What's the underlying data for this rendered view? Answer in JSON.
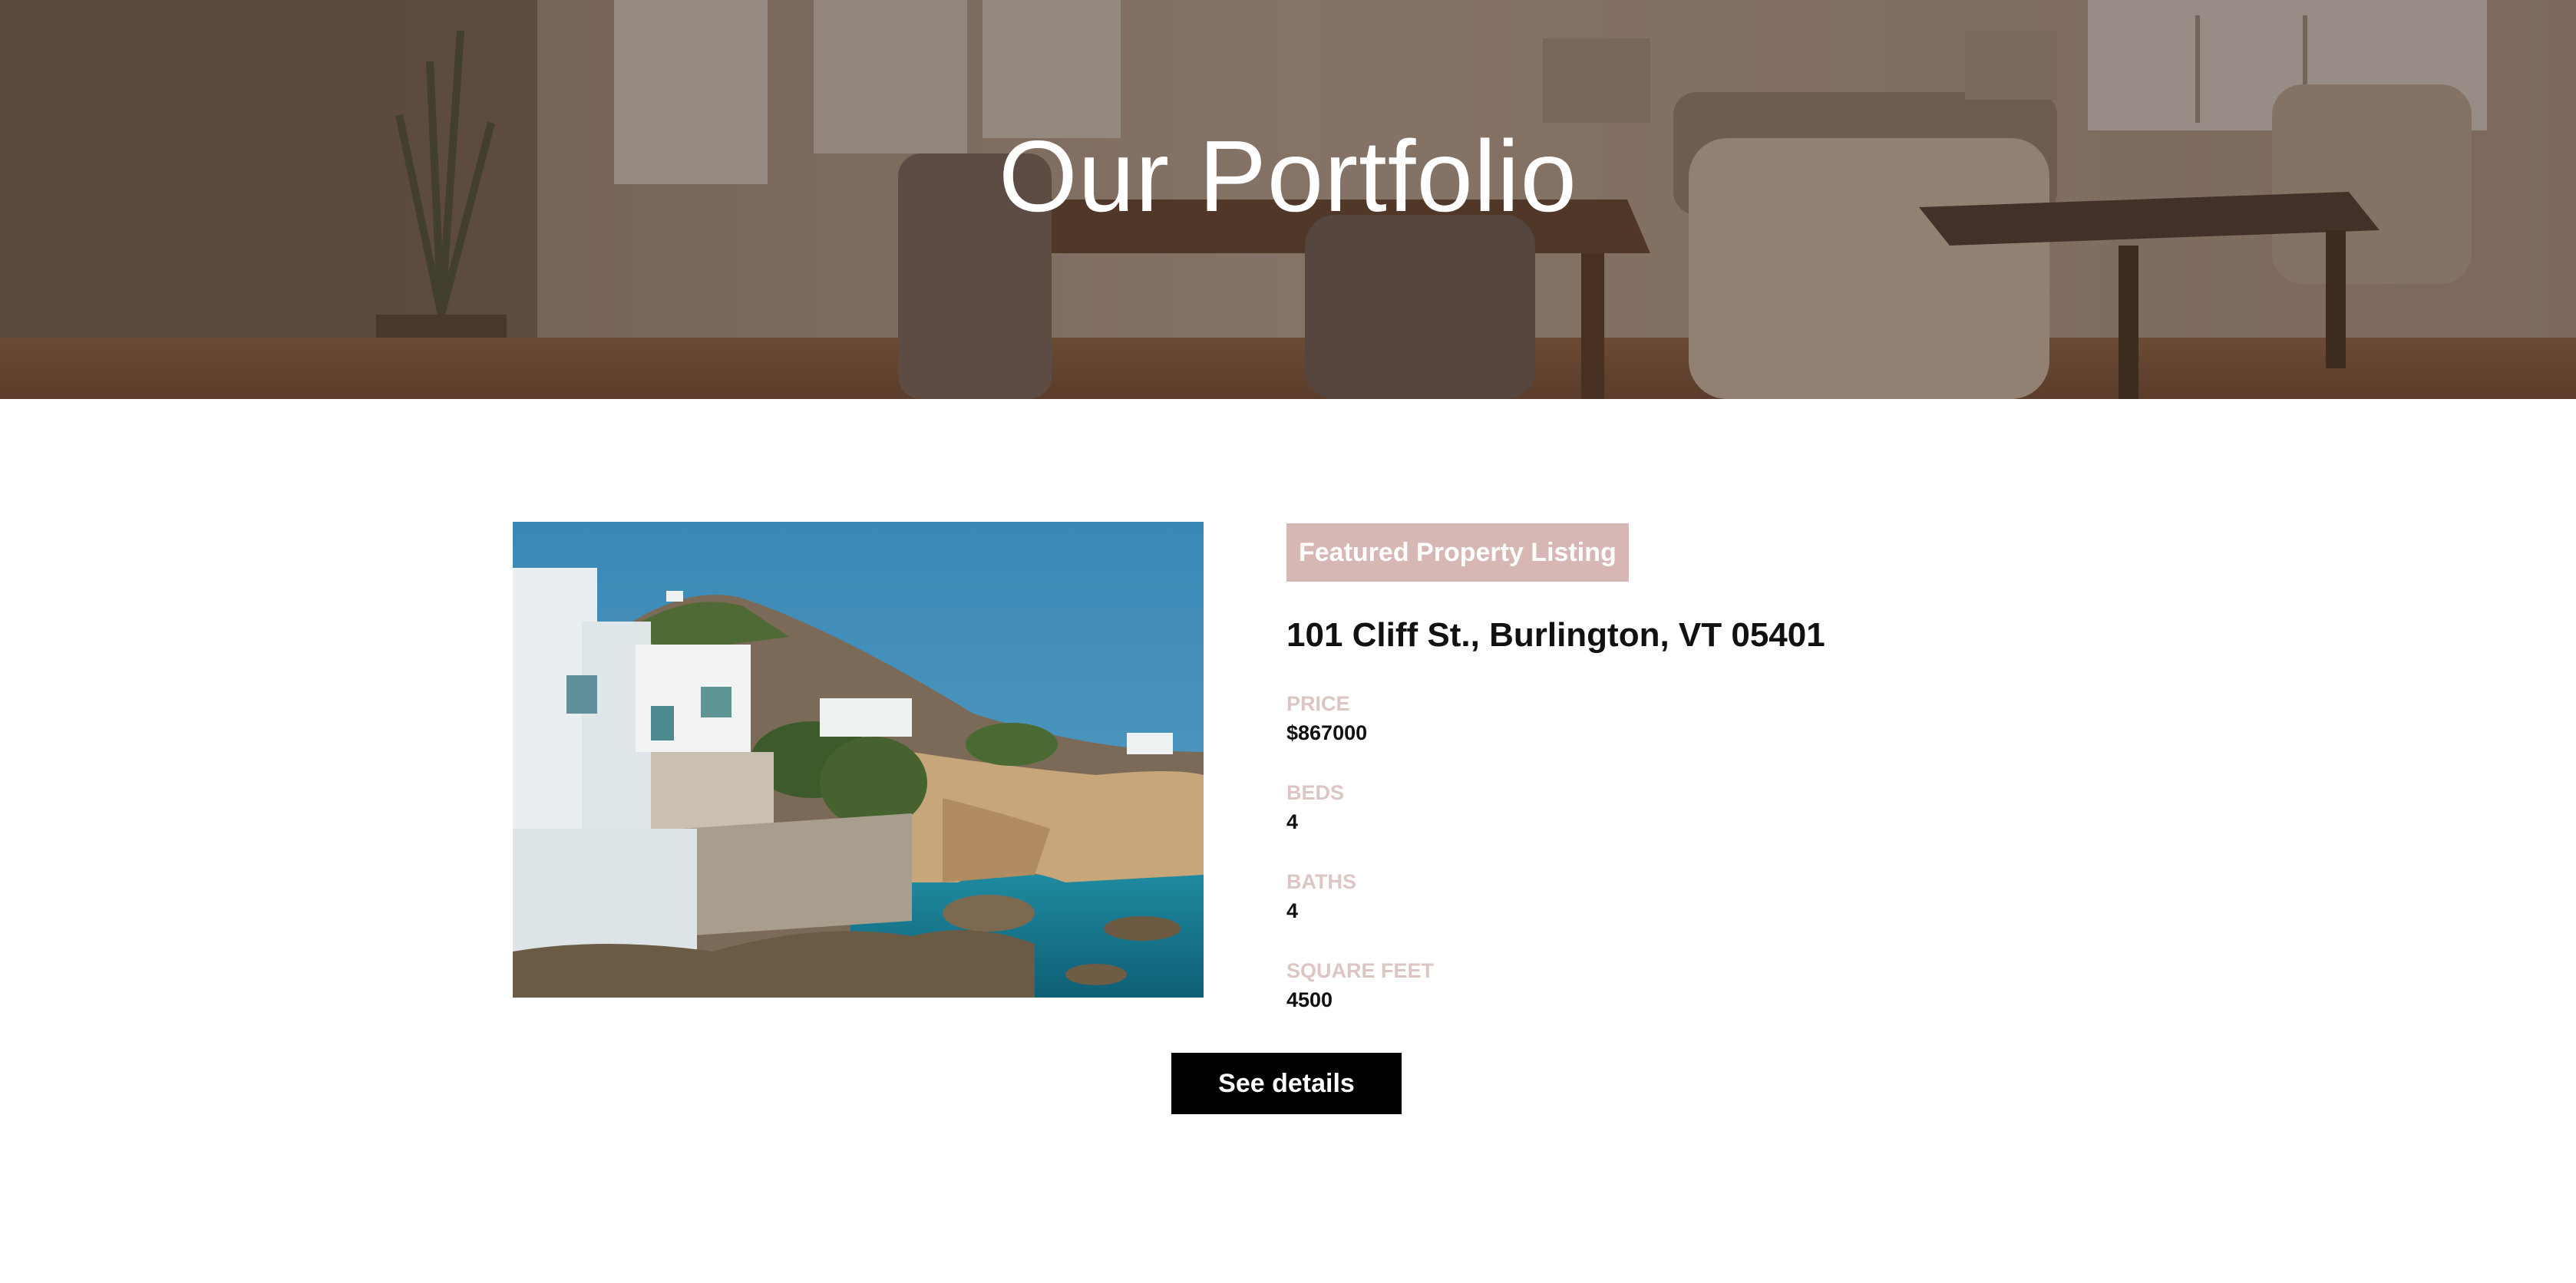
{
  "hero": {
    "title": "Our Portfolio"
  },
  "listing": {
    "badge": "Featured Property Listing",
    "address": "101 Cliff St., Burlington, VT 05401",
    "fields": [
      {
        "label": "PRICE",
        "value": "$867000"
      },
      {
        "label": "BEDS",
        "value": "4"
      },
      {
        "label": "BATHS",
        "value": "4"
      },
      {
        "label": "SQUARE FEET",
        "value": "4500"
      }
    ],
    "button_label": "See details"
  },
  "colors": {
    "badge_bg": "#d7b7b4",
    "label_text": "#dcc6c3",
    "button_bg": "#000000",
    "hero_overlay": "#46342c"
  }
}
